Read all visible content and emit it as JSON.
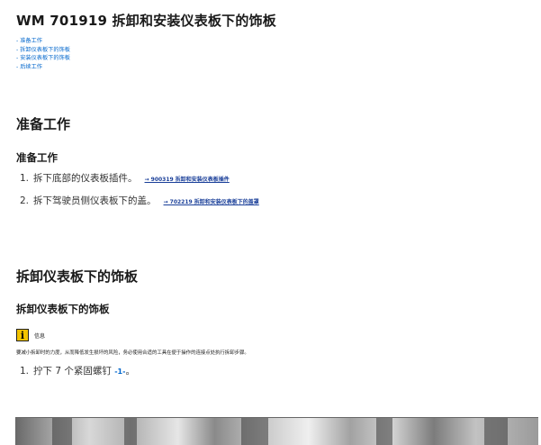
{
  "title": "WM 701919 拆卸和安装仪表板下的饰板",
  "toc": [
    "准备工作",
    "拆卸仪表板下的饰板",
    "安装仪表板下的饰板",
    "后续工作"
  ],
  "section_prep": {
    "heading": "准备工作",
    "subheading": "准备工作",
    "steps": [
      {
        "num": "1.",
        "text": "拆下底部的仪表板插件。",
        "ref": "→ 900319 拆卸和安装仪表板插件"
      },
      {
        "num": "2.",
        "text": "拆下驾驶员侧仪表板下的盖。",
        "ref": "→ 702219 拆卸和安装仪表板下的盖罩"
      }
    ]
  },
  "section_remove": {
    "heading": "拆卸仪表板下的饰板",
    "subheading": "拆卸仪表板下的饰板",
    "info_icon": "info-icon",
    "info_label": "信息",
    "info_text": "要减小拆卸时的力度，从而降低发生损坏的风险，务必使用合适的工具在便于操作的连接点处执行拆卸步骤。",
    "steps": [
      {
        "num": "1.",
        "text": "拧下 7 个紧固螺钉",
        "callout": "-1-",
        "suffix": "。"
      }
    ]
  },
  "colors": {
    "link": "#0066cc",
    "ref_link": "#1a3f99",
    "info_icon_bg": "#f2c300"
  }
}
